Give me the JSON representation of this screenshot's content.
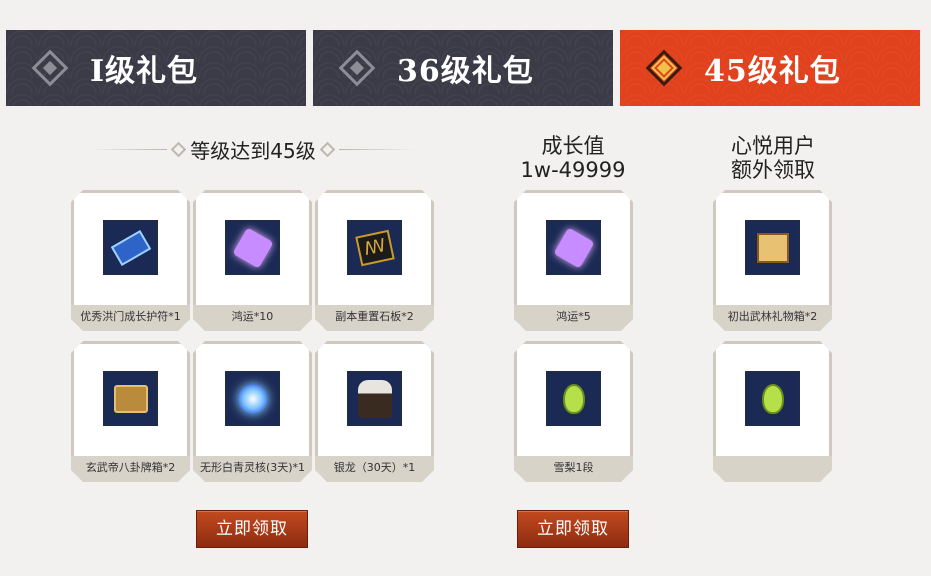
{
  "tabs": [
    {
      "label": "I级礼包",
      "active": false
    },
    {
      "label": "36级礼包",
      "active": false
    },
    {
      "label": "45级礼包",
      "active": true
    }
  ],
  "level_section": {
    "heading": "等级达到45级",
    "items": [
      {
        "name": "优秀洪门成长护符*1",
        "icon": "talisman-icon"
      },
      {
        "name": "鸿运*10",
        "icon": "purple-crystal-icon"
      },
      {
        "name": "副本重置石板*2",
        "icon": "stone-tablet-icon"
      },
      {
        "name": "玄武帝八卦牌箱*2",
        "icon": "bagua-chest-icon"
      },
      {
        "name": "无形白青灵核(3天)*1",
        "icon": "spirit-orb-icon"
      },
      {
        "name": "银龙（30天）*1",
        "icon": "fur-coat-icon"
      }
    ],
    "button": "立即领取"
  },
  "growth_section": {
    "heading_line1": "成长值",
    "heading_line2": "1w-49999",
    "items": [
      {
        "name": "鸿运*5",
        "icon": "purple-crystal-icon"
      },
      {
        "name": "雪梨1段",
        "icon": "pear-icon"
      }
    ],
    "button": "立即领取"
  },
  "vip_section": {
    "heading_line1": "心悦用户",
    "heading_line2": "额外领取",
    "items": [
      {
        "name": "初出武林礼物箱*2",
        "icon": "gift-box-icon"
      },
      {
        "name": "",
        "icon": "pear-icon"
      }
    ]
  }
}
